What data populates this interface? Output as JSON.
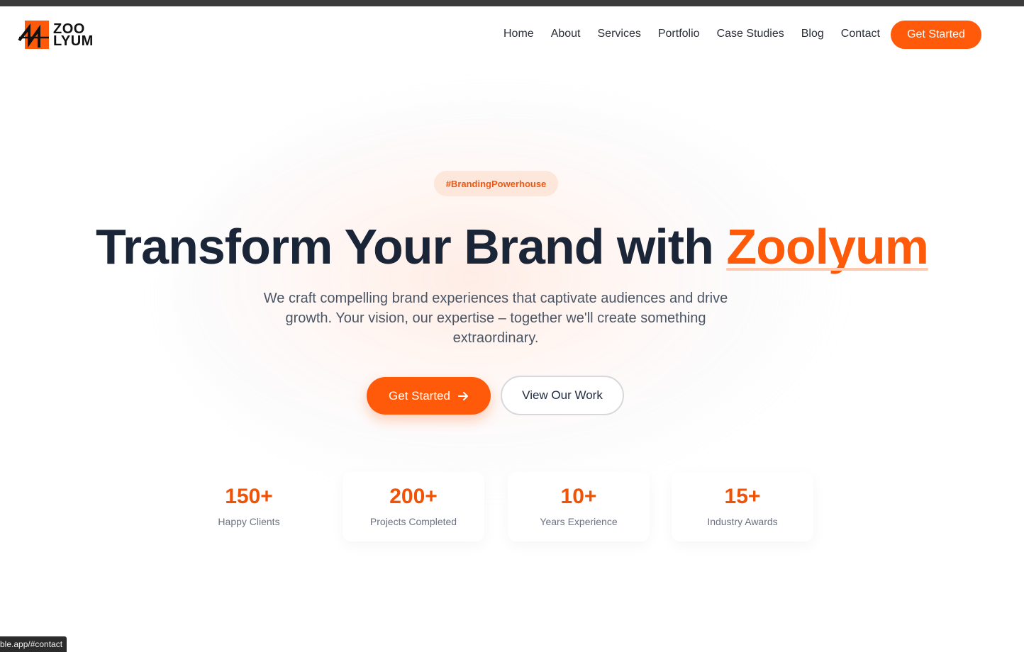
{
  "brand": {
    "logo_line1": "ZOO",
    "logo_line2": "LYUM",
    "accent_color": "#ff5a0a"
  },
  "nav": {
    "items": [
      {
        "label": "Home"
      },
      {
        "label": "About"
      },
      {
        "label": "Services"
      },
      {
        "label": "Portfolio"
      },
      {
        "label": "Case Studies"
      },
      {
        "label": "Blog"
      },
      {
        "label": "Contact"
      }
    ],
    "cta_label": "Get Started"
  },
  "hero": {
    "badge": "#BrandingPowerhouse",
    "headline_main": "Transform Your Brand with",
    "headline_accent": "Zoolyum",
    "subtitle": "We craft compelling brand experiences that captivate audiences and drive growth. Your vision, our expertise – together we'll create something extraordinary.",
    "primary_button": "Get Started",
    "secondary_button": "View Our Work"
  },
  "stats": [
    {
      "value": "150+",
      "label": "Happy Clients"
    },
    {
      "value": "200+",
      "label": "Projects Completed"
    },
    {
      "value": "10+",
      "label": "Years Experience"
    },
    {
      "value": "15+",
      "label": "Industry Awards"
    }
  ],
  "status_bar": {
    "url": "ble.app/#contact"
  }
}
